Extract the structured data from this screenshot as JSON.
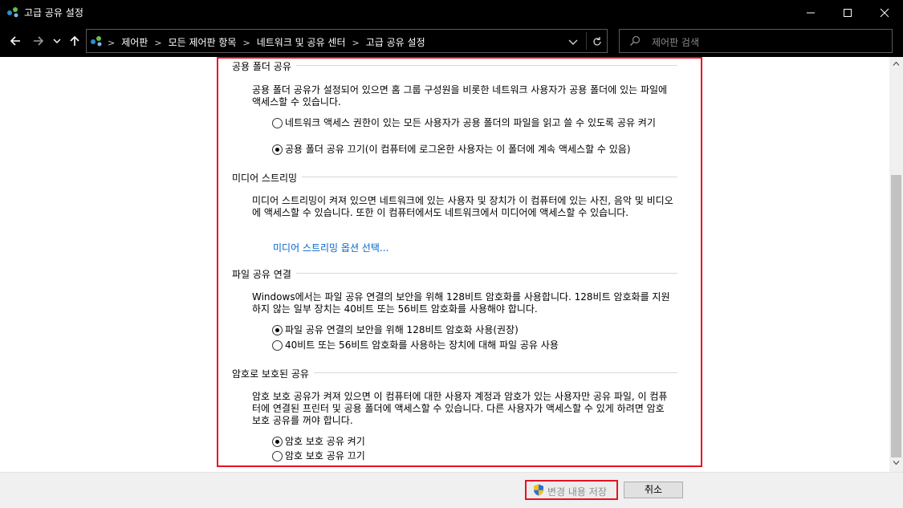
{
  "window": {
    "title": "고급 공유 설정"
  },
  "address_bar": {
    "breadcrumbs": [
      "제어판",
      "모든 제어판 항목",
      "네트워크 및 공유 센터",
      "고급 공유 설정"
    ],
    "separator": ">"
  },
  "search": {
    "placeholder": "제어판 검색"
  },
  "sections": {
    "public_folder": {
      "heading": "공용 폴더 공유",
      "description": "공용 폴더 공유가 설정되어 있으면 홈 그룹 구성원을 비롯한 네트워크 사용자가 공용 폴더에 있는 파일에 액세스할 수 있습니다.",
      "options": [
        {
          "label": "네트워크 액세스 권한이 있는 모든 사용자가 공용 폴더의 파일을 읽고 쓸 수 있도록 공유 켜기",
          "selected": false
        },
        {
          "label": "공용 폴더 공유 끄기(이 컴퓨터에 로그온한 사용자는 이 폴더에 계속 액세스할 수 있음)",
          "selected": true
        }
      ]
    },
    "media_streaming": {
      "heading": "미디어 스트리밍",
      "description": "미디어 스트리밍이 켜져 있으면 네트워크에 있는 사용자 및 장치가 이 컴퓨터에 있는 사진, 음악 및 비디오에 액세스할 수 있습니다. 또한 이 컴퓨터에서도 네트워크에서 미디어에 액세스할 수 있습니다.",
      "link": "미디어 스트리밍 옵션 선택..."
    },
    "file_sharing": {
      "heading": "파일 공유 연결",
      "description": "Windows에서는 파일 공유 연결의 보안을 위해 128비트 암호화를 사용합니다. 128비트 암호화를 지원하지 않는 일부 장치는 40비트 또는 56비트 암호화를 사용해야 합니다.",
      "options": [
        {
          "label": "파일 공유 연결의 보안을 위해 128비트 암호화 사용(권장)",
          "selected": true
        },
        {
          "label": "40비트 또는 56비트 암호화를 사용하는 장치에 대해 파일 공유 사용",
          "selected": false
        }
      ]
    },
    "password_protected": {
      "heading": "암호로 보호된 공유",
      "description": "암호 보호 공유가 켜져 있으면 이 컴퓨터에 대한 사용자 계정과 암호가 있는 사용자만 공유 파일, 이 컴퓨터에 연결된 프린터 및 공용 폴더에 액세스할 수 있습니다. 다른 사용자가 액세스할 수 있게 하려면 암호 보호 공유를 꺼야 합니다.",
      "options": [
        {
          "label": "암호 보호 공유 켜기",
          "selected": true
        },
        {
          "label": "암호 보호 공유 끄기",
          "selected": false
        }
      ]
    }
  },
  "footer": {
    "save_label": "변경 내용 저장",
    "cancel_label": "취소"
  },
  "colors": {
    "highlight": "#e81123",
    "link": "#0066cc",
    "titlebar": "#000000"
  }
}
